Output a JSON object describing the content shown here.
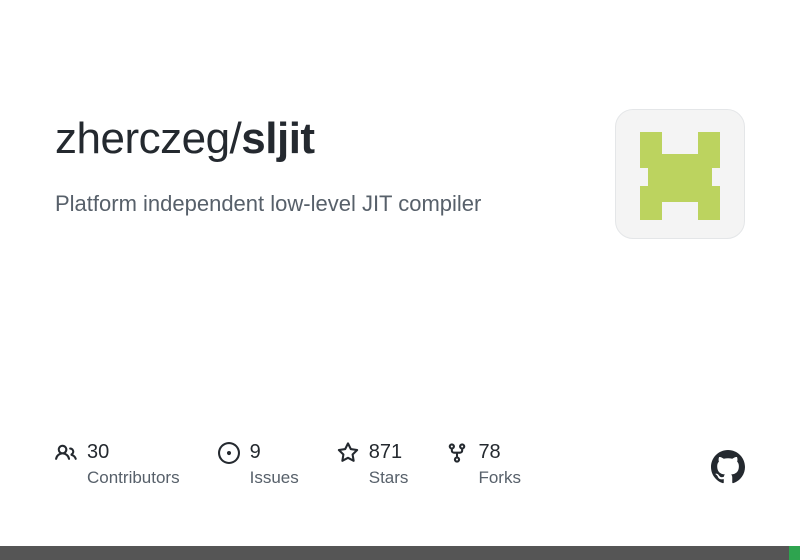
{
  "repo": {
    "owner": "zherczeg",
    "name": "sljit",
    "description": "Platform independent low-level JIT compiler"
  },
  "stats": {
    "contributors": {
      "value": "30",
      "label": "Contributors"
    },
    "issues": {
      "value": "9",
      "label": "Issues"
    },
    "stars": {
      "value": "871",
      "label": "Stars"
    },
    "forks": {
      "value": "78",
      "label": "Forks"
    }
  },
  "lang_bar": {
    "grey_pct": "98.6%",
    "green_pct": "1.4%",
    "grey_color": "#555555",
    "green_color": "#2ea44f"
  },
  "avatar": {
    "bg": "#bcd35f"
  }
}
